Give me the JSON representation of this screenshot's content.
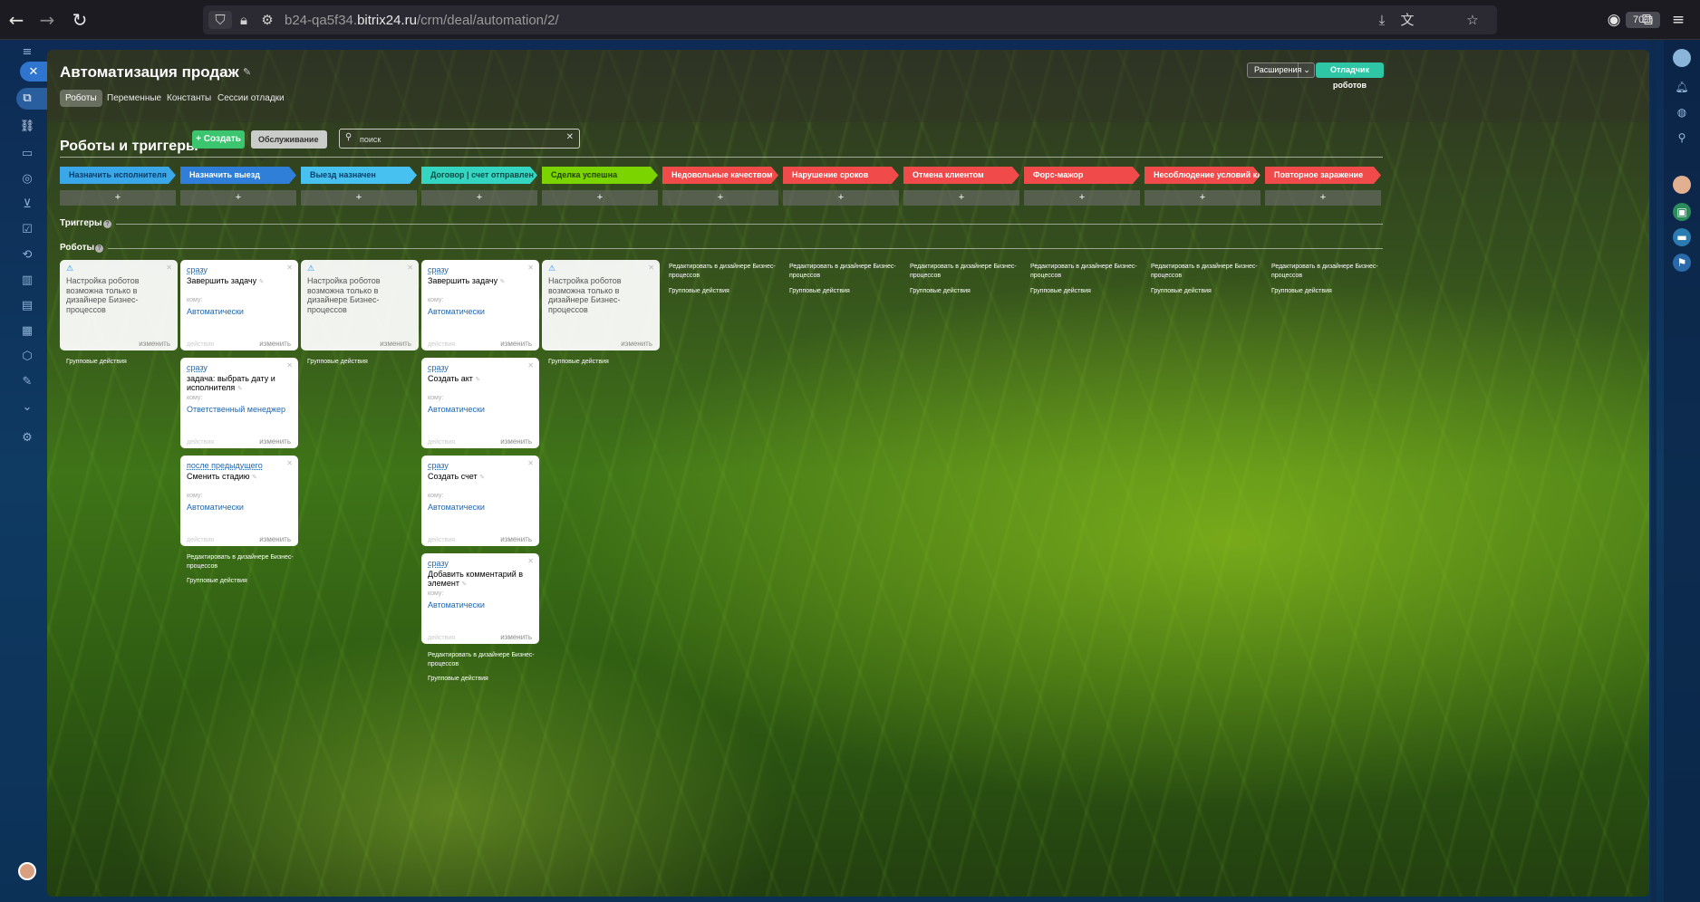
{
  "browser": {
    "url_prefix": "b24-qa5f34.",
    "url_host": "bitrix24.ru",
    "url_path": "/crm/deal/automation/2/",
    "zoom": "70%"
  },
  "page": {
    "title": "Автоматизация продаж",
    "tabs": [
      "Роботы",
      "Переменные",
      "Константы",
      "Сессии отладки"
    ],
    "ext_button": "Расширения",
    "debug_button": "Отладчик роботов"
  },
  "toolbar": {
    "section_title": "Роботы и триггеры",
    "create_label": "Создать",
    "service_label": "Обслуживание",
    "search_placeholder": "поиск"
  },
  "stages": [
    {
      "name": "Назначить исполнителя",
      "color": "#3aa7e8"
    },
    {
      "name": "Назначить выезд",
      "color": "#2f7fd8"
    },
    {
      "name": "Выезд назначен",
      "color": "#47c1f0"
    },
    {
      "name": "Договор | счет отправлен",
      "color": "#35d6c1"
    },
    {
      "name": "Сделка успешна",
      "color": "#7bd300"
    },
    {
      "name": "Недовольные качеством",
      "color": "#f04a4a"
    },
    {
      "name": "Нарушение сроков",
      "color": "#f04a4a"
    },
    {
      "name": "Отмена клиентом",
      "color": "#f04a4a"
    },
    {
      "name": "Форс-мажор",
      "color": "#f04a4a"
    },
    {
      "name": "Несоблюдение условий кли...",
      "color": "#f04a4a"
    },
    {
      "name": "Повторное заражение",
      "color": "#f04a4a"
    }
  ],
  "add_symbol": "+",
  "sections": {
    "triggers": "Триггеры",
    "robots": "Роботы",
    "help": "?"
  },
  "labels": {
    "to": "кому:",
    "actions": "действия",
    "edit": "изменить",
    "group_actions": "Групповые действия",
    "designer_link": "Редактировать в дизайнере Бизнес-процессов",
    "warning": "Настройка роботов возможна только в дизайнере Бизнес-процессов"
  },
  "robots": {
    "col2": [
      {
        "trigger": "сразу",
        "title": "Завершить задачу",
        "responsible": "Автоматически"
      },
      {
        "trigger": "сразу",
        "title": "задача: выбрать дату и исполнителя",
        "responsible": "Ответственный менеджер"
      },
      {
        "trigger": "после предыдущего",
        "title": "Сменить стадию",
        "responsible": "Автоматически"
      }
    ],
    "col4": [
      {
        "trigger": "сразу",
        "title": "Завершить задачу",
        "responsible": "Автоматически"
      },
      {
        "trigger": "сразу",
        "title": "Создать акт",
        "responsible": "Автоматически"
      },
      {
        "trigger": "сразу",
        "title": "Создать счет",
        "responsible": "Автоматически"
      },
      {
        "trigger": "сразу",
        "title": "Добавить комментарий в элемент",
        "responsible": "Автоматически"
      }
    ]
  },
  "theme": {
    "accent_green": "#3bc56f",
    "debug_teal": "#2fc6a6",
    "link_blue": "#2067b0"
  }
}
